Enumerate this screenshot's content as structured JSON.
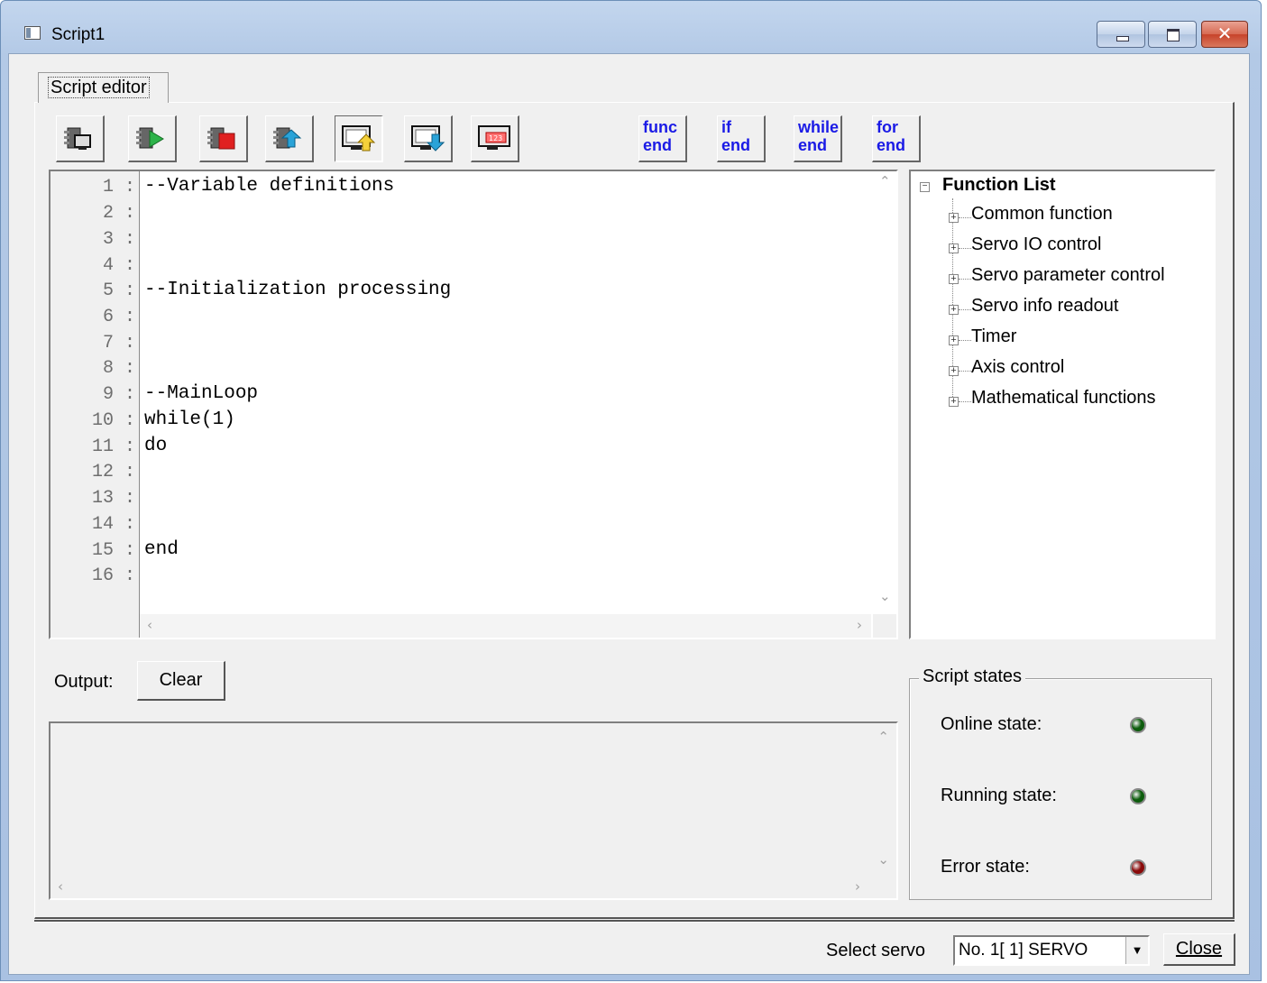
{
  "window": {
    "title": "Script1"
  },
  "tabs": [
    {
      "label": "Script editor"
    }
  ],
  "toolbar": {
    "icon_buttons": [
      "new-script-icon",
      "run-script-icon",
      "stop-script-icon",
      "upload-script-icon",
      "upload-to-pc-icon",
      "download-to-servo-icon",
      "numeric-display-icon"
    ],
    "keyword_buttons": [
      {
        "line1": "func",
        "line2": "end"
      },
      {
        "line1": "if",
        "line2": "end"
      },
      {
        "line1": "while",
        "line2": "end"
      },
      {
        "line1": "for",
        "line2": "end"
      }
    ]
  },
  "editor": {
    "line_numbers": [
      "1 :",
      "2 :",
      "3 :",
      "4 :",
      "5 :",
      "6 :",
      "7 :",
      "8 :",
      "9 :",
      "10 :",
      "11 :",
      "12 :",
      "13 :",
      "14 :",
      "15 :",
      "16 :"
    ],
    "lines": [
      "--Variable definitions",
      "",
      "",
      "",
      "--Initialization processing",
      "",
      "",
      "",
      "--MainLoop",
      "while(1)",
      "do",
      "",
      "",
      "",
      "end",
      ""
    ]
  },
  "function_list": {
    "root": "Function List",
    "items": [
      "Common function",
      "Servo IO control",
      "Servo parameter control",
      "Servo info readout",
      "Timer",
      "Axis control",
      "Mathematical functions"
    ]
  },
  "output": {
    "label": "Output:",
    "clear_label": "Clear",
    "content": ""
  },
  "script_states": {
    "title": "Script states",
    "online_label": "Online state:",
    "running_label": "Running state:",
    "error_label": "Error state:",
    "online_color": "#0d5c0d",
    "running_color": "#0d5c0d",
    "error_color": "#8a0a0a"
  },
  "footer": {
    "select_servo_label": "Select servo",
    "servo_value": "No. 1[  1] SERVO",
    "close_label": "Close"
  }
}
